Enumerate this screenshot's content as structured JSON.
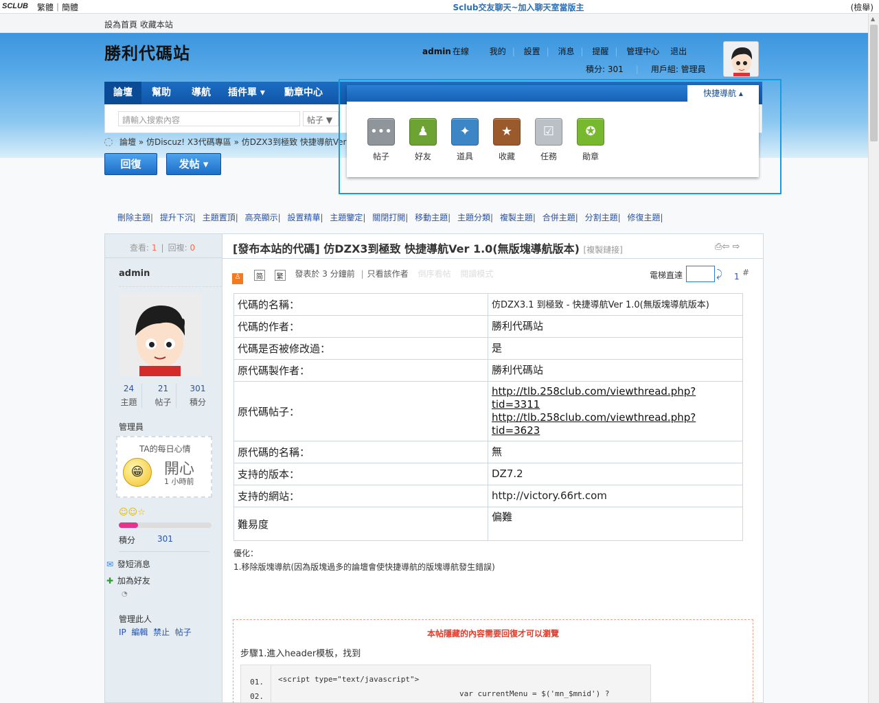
{
  "topbar": {
    "logo": "SCLUB",
    "lang": "繁體｜簡體",
    "center": "Sclub交友聊天~加入聊天室當版主",
    "right": "(檢舉)"
  },
  "toplinks": "設為首頁 收藏本站",
  "site_title": "勝利代碼站",
  "user": {
    "name": "admin",
    "status": "在線",
    "links": [
      "我的",
      "設置",
      "消息",
      "提醒",
      "管理中心",
      "退出"
    ],
    "points": "積分: 301",
    "group": "用戶組: 管理員"
  },
  "nav": [
    "論壇",
    "幫助",
    "導航",
    "插件單 ▾",
    "勳章中心"
  ],
  "quicknav": {
    "tab": "快捷導航 ▴",
    "items": [
      {
        "label": "帖子",
        "color": "#8e959b",
        "glyph": "•••"
      },
      {
        "label": "好友",
        "color": "#6da332",
        "glyph": "♟"
      },
      {
        "label": "道具",
        "color": "#3d86c6",
        "glyph": "✦"
      },
      {
        "label": "收藏",
        "color": "#9b5a2b",
        "glyph": "★"
      },
      {
        "label": "任務",
        "color": "#b9c0c6",
        "glyph": "☑"
      },
      {
        "label": "勛章",
        "color": "#77b82f",
        "glyph": "✪"
      }
    ]
  },
  "search": {
    "placeholder": "請輸入搜索內容",
    "type": "帖子 ▼"
  },
  "breadcrumb": "論壇 » 仿Discuz! X3代碼專區 » 仿DZX3到極致 快捷導航Ver 1",
  "buttons": {
    "reply": "回復",
    "post": "发帖 ▾"
  },
  "mod_links": [
    "刪除主題",
    "提升下沉",
    "主題置頂",
    "高亮顯示",
    "設置精華",
    "主題鑒定",
    "關閉打開",
    "移動主題",
    "主題分類",
    "複製主題",
    "合併主題",
    "分割主題",
    "修復主題"
  ],
  "thread": {
    "views_label": "查看:",
    "views": "1",
    "replies_label": "回複:",
    "replies": "0",
    "title": "[發布本站的代碼] 仿DZX3到極致 快捷導航Ver 1.0(無版塊導航版本)",
    "copy": "[複製鏈接]"
  },
  "postmeta": {
    "posted": "發表於 3 分鐘前",
    "only_author": "只看該作者",
    "reverse": "倒序看帖",
    "read_mode": "閱讀模式",
    "goto": "電梯直達",
    "floor": "1",
    "hash": "#"
  },
  "author": {
    "name": "admin",
    "stats": [
      {
        "num": "24",
        "label": "主題"
      },
      {
        "num": "21",
        "label": "帖子"
      },
      {
        "num": "301",
        "label": "積分"
      }
    ],
    "group": "管理員",
    "mood_title": "TA的每日心情",
    "mood": "開心",
    "mood_time": "1 小時前",
    "points_label": "積分",
    "points": "301",
    "actions": [
      "發短消息",
      "加為好友"
    ],
    "manage": "管理此人",
    "manage_links": [
      "IP",
      "編輯",
      "禁止",
      "帖子"
    ]
  },
  "info_rows": [
    {
      "k": "代碼的名稱：",
      "v": "仿DZX3.1 到極致 - 快捷導航Ver 1.0(無版塊導航版本)"
    },
    {
      "k": "代碼的作者：",
      "v": "勝利代碼站"
    },
    {
      "k": "代碼是否被修改過：",
      "v": "是"
    },
    {
      "k": "原代碼製作者：",
      "v": "勝利代碼站"
    },
    {
      "k": "原代碼帖子：",
      "v": "http://tlb.258club.com/viewthread.php?tid=3311",
      "v2": "http://tlb.258club.com/viewthread.php?tid=3623"
    },
    {
      "k": "原代碼的名稱：",
      "v": "無"
    },
    {
      "k": "支持的版本：",
      "v": "DZ7.2"
    },
    {
      "k": "支持的網站：",
      "v": "http://victory.66rt.com"
    },
    {
      "k": "難易度",
      "v": "偏難"
    }
  ],
  "optimize": {
    "title": "優化：",
    "text": "1.移除版塊導航(因為版塊過多的論壇會使快捷導航的版塊導航發生錯誤)"
  },
  "hidden": {
    "notice": "本帖隱藏的內容需要回復才可以瀏覽",
    "step": "步驟1.進入header模板，找到",
    "lines": [
      "01.",
      "02."
    ],
    "code1": "<script type=\"text/javascript\">",
    "code2": "var currentMenu = $('mn_$mnid') ?"
  }
}
